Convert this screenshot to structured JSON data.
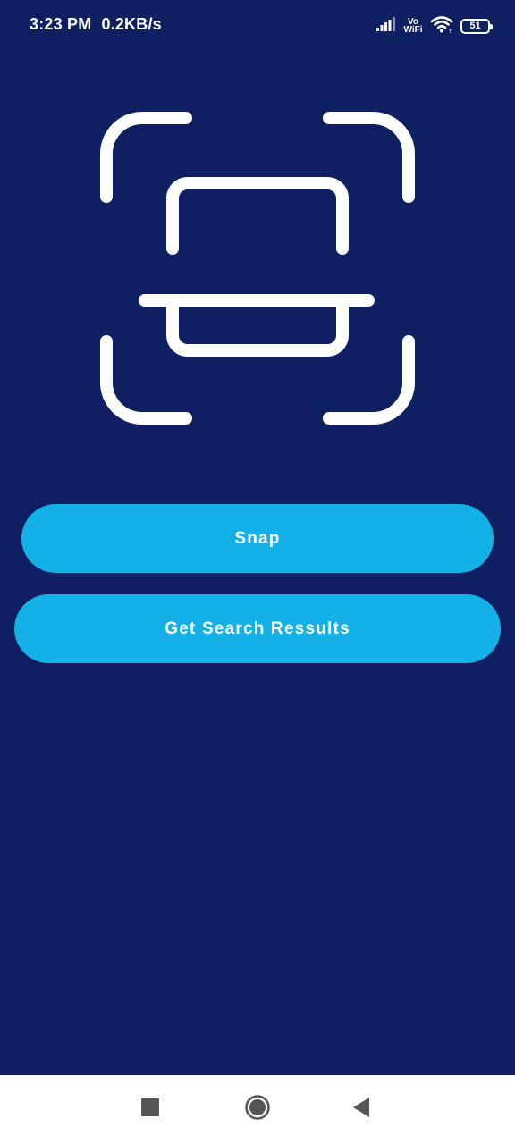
{
  "status_bar": {
    "time": "3:23 PM",
    "network_speed": "0.2KB/s",
    "vowifi_line1": "Vo",
    "vowifi_line2": "WiFi",
    "battery_level": "51",
    "icons": [
      "signal-icon",
      "wifi-icon",
      "battery-icon"
    ]
  },
  "main": {
    "illustration_icon": "scan-document-icon",
    "snap_label": "Snap",
    "search_label": "Get Search Ressults"
  },
  "nav_bar": {
    "icons": [
      "recents-icon",
      "home-icon",
      "back-icon"
    ]
  },
  "colors": {
    "background": "#0e2062",
    "button": "#13b1e7",
    "button_text": "#ffffff",
    "nav_bar": "#ffffff",
    "nav_icon": "#555555"
  }
}
